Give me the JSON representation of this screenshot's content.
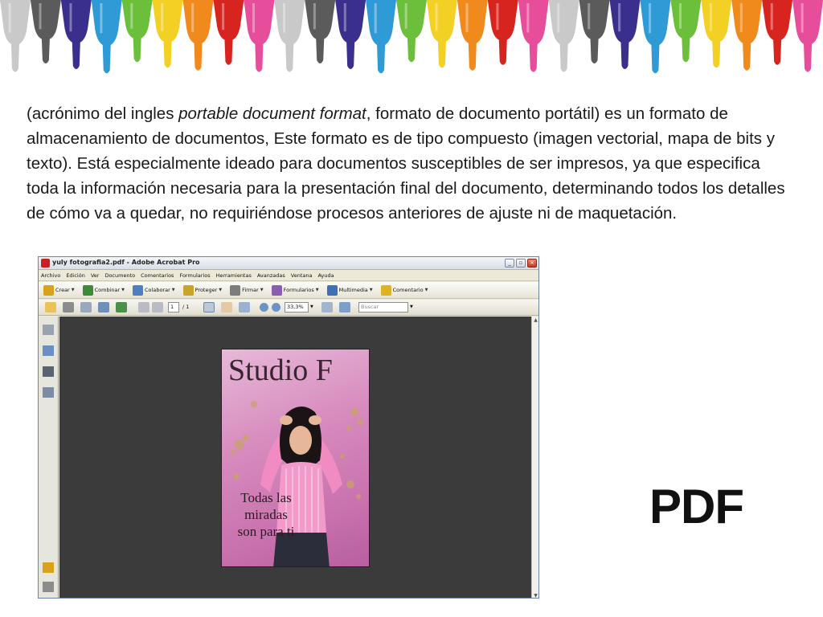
{
  "paragraph": {
    "prefix": " (acrónimo del ingles ",
    "italic": "portable document  format",
    "suffix": ", formato de documento portátil) es un formato de almacenamiento de documentos, Este formato es de tipo compuesto (imagen vectorial, mapa de bits y texto). Está especialmente ideado para documentos susceptibles de ser impresos, ya que especifica toda la información necesaria para la presentación final del documento, determinando todos los detalles de cómo va a quedar, no requiriéndose procesos anteriores de ajuste ni de maquetación."
  },
  "acrobat": {
    "window_title": "yuly fotografia2.pdf - Adobe Acrobat Pro",
    "menu": [
      "Archivo",
      "Edición",
      "Ver",
      "Documento",
      "Comentarios",
      "Formularios",
      "Herramientas",
      "Avanzadas",
      "Ventana",
      "Ayuda"
    ],
    "tasks": [
      {
        "label": "Crear",
        "icon": "create-pdf-icon",
        "color": "#d9a21b"
      },
      {
        "label": "Combinar",
        "icon": "combine-icon",
        "color": "#3d8a3a"
      },
      {
        "label": "Colaborar",
        "icon": "collaborate-icon",
        "color": "#4f7fc0"
      },
      {
        "label": "Proteger",
        "icon": "lock-icon",
        "color": "#c9a428"
      },
      {
        "label": "Firmar",
        "icon": "pen-icon",
        "color": "#7d7d7d"
      },
      {
        "label": "Formularios",
        "icon": "forms-icon",
        "color": "#8a5fb0"
      },
      {
        "label": "Multimedia",
        "icon": "multimedia-icon",
        "color": "#3f6fb5"
      },
      {
        "label": "Comentario",
        "icon": "comment-icon",
        "color": "#e0b21d"
      }
    ],
    "toolbar": {
      "page_current": "1",
      "page_total": "/ 1",
      "zoom": "33,3%",
      "search_placeholder": "Buscar"
    }
  },
  "cover": {
    "title": "Studio F",
    "tagline_lines": [
      "Todas las",
      "miradas",
      "son para  ti"
    ]
  },
  "pdf_label": "PDF",
  "paint_colors": [
    "#c9c9c9",
    "#5b5b5b",
    "#3a2f8c",
    "#2e9ad6",
    "#6cbf3a",
    "#f2d024",
    "#f08a1c",
    "#d8241f",
    "#e64d9a",
    "#c9c9c9",
    "#5b5b5b",
    "#3a2f8c",
    "#2e9ad6",
    "#6cbf3a",
    "#f2d024",
    "#f08a1c",
    "#d8241f",
    "#e64d9a",
    "#c9c9c9",
    "#5b5b5b",
    "#3a2f8c",
    "#2e9ad6",
    "#6cbf3a",
    "#f2d024",
    "#f08a1c",
    "#d8241f",
    "#e64d9a"
  ]
}
